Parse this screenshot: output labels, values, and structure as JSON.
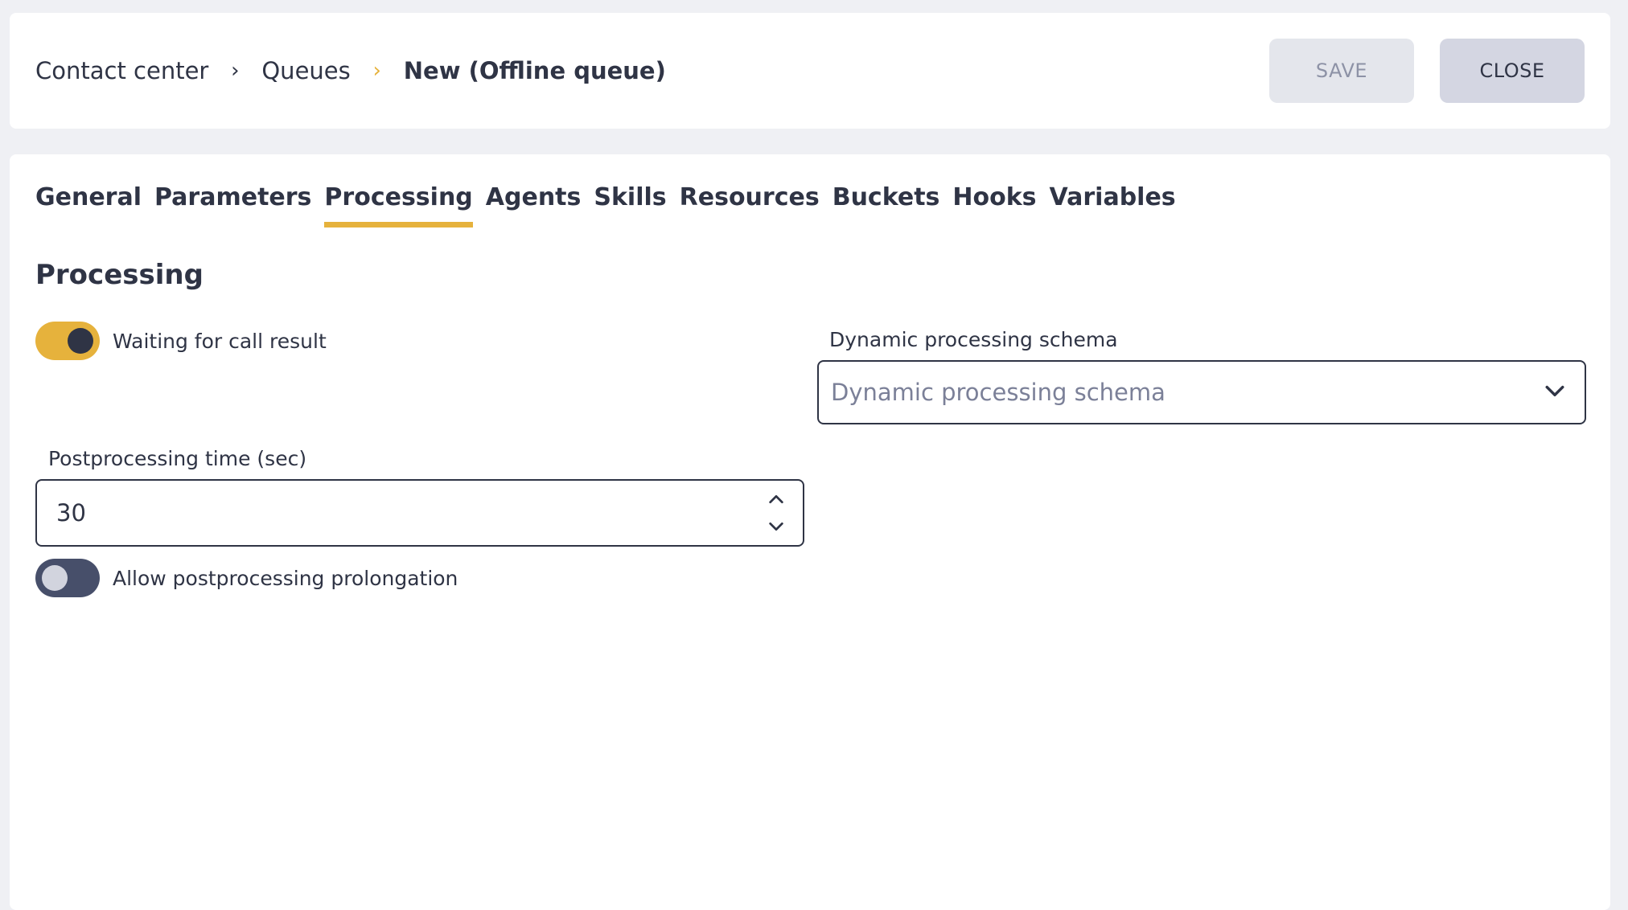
{
  "breadcrumb": {
    "items": [
      "Contact center",
      "Queues"
    ],
    "current": "New (Offline queue)",
    "separator": "›"
  },
  "header": {
    "save_label": "SAVE",
    "close_label": "CLOSE"
  },
  "tabs": [
    {
      "label": "General",
      "active": false
    },
    {
      "label": "Parameters",
      "active": false
    },
    {
      "label": "Processing",
      "active": true
    },
    {
      "label": "Agents",
      "active": false
    },
    {
      "label": "Skills",
      "active": false
    },
    {
      "label": "Resources",
      "active": false
    },
    {
      "label": "Buckets",
      "active": false
    },
    {
      "label": "Hooks",
      "active": false
    },
    {
      "label": "Variables",
      "active": false
    }
  ],
  "section": {
    "title": "Processing"
  },
  "fields": {
    "waiting_toggle": {
      "label": "Waiting for call result",
      "checked": true
    },
    "schema_select": {
      "label": "Dynamic processing schema",
      "placeholder": "Dynamic processing schema"
    },
    "postprocessing_time": {
      "label": "Postprocessing time (sec)",
      "value": "30"
    },
    "prolongation_toggle": {
      "label": "Allow postprocessing prolongation",
      "checked": false
    }
  },
  "colors": {
    "accent": "#e6b23c",
    "text": "#2f3445",
    "background": "#eff0f4"
  }
}
